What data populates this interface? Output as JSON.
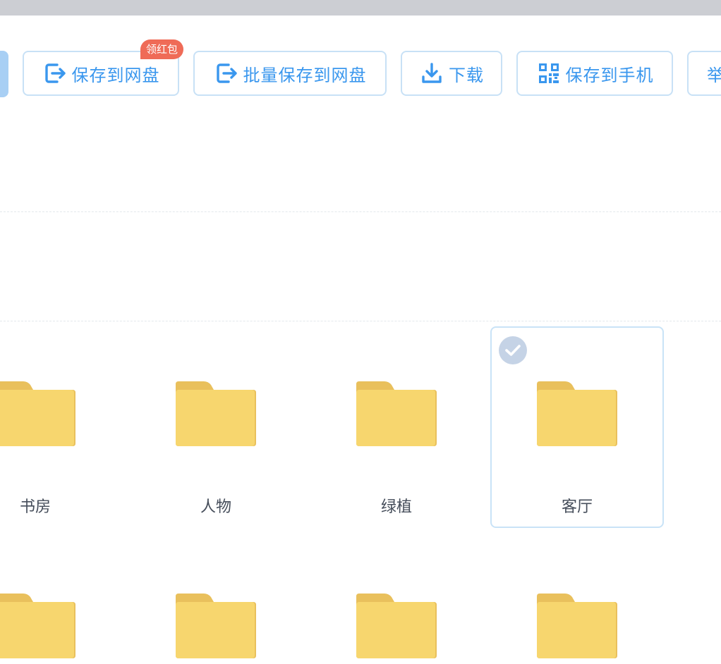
{
  "toolbar": {
    "save_to_cloud": "保存到网盘",
    "badge": "领红包",
    "batch_save": "批量保存到网盘",
    "download": "下载",
    "save_to_phone": "保存到手机",
    "report": "举"
  },
  "folders": {
    "row1": [
      "书房",
      "人物",
      "绿植",
      "客厅"
    ],
    "selected": "客厅"
  },
  "colors": {
    "accent": "#3a97ee",
    "button_border": "#c8e1f6",
    "badge": "#ef6b57",
    "folder": "#f7d66e",
    "folder_tab": "#e9c05c"
  }
}
